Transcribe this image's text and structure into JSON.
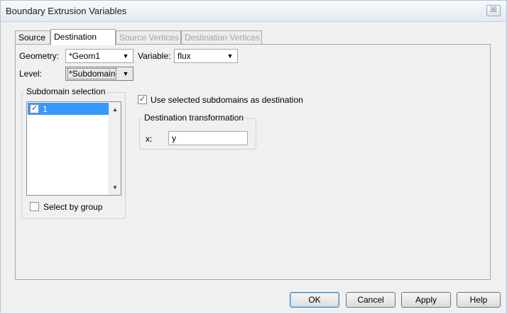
{
  "window": {
    "title": "Boundary Extrusion Variables",
    "close_glyph": "☒"
  },
  "tabs": [
    {
      "label": "Source",
      "state": "normal"
    },
    {
      "label": "Destination",
      "state": "active"
    },
    {
      "label": "Source Vertices",
      "state": "disabled"
    },
    {
      "label": "Destination Vertices",
      "state": "disabled"
    }
  ],
  "geometry": {
    "label": "Geometry:",
    "value": "*Geom1"
  },
  "variable": {
    "label": "Variable:",
    "value": "flux"
  },
  "level": {
    "label": "Level:",
    "value": "*Subdomain"
  },
  "subdomain_selection": {
    "title": "Subdomain selection",
    "items": [
      {
        "label": "1",
        "checked": true,
        "selected": true
      }
    ],
    "select_by_group": {
      "label": "Select by group",
      "checked": false
    }
  },
  "use_selected": {
    "label": "Use selected subdomains as destination",
    "checked": true
  },
  "destination_transformation": {
    "title": "Destination transformation",
    "x_label": "x:",
    "x_value": "y"
  },
  "buttons": {
    "ok": "OK",
    "cancel": "Cancel",
    "apply": "Apply",
    "help": "Help"
  },
  "icons": {
    "dropdown": "chevron-down-icon",
    "check": "check-icon",
    "close": "close-icon",
    "scroll_up": "scroll-up-icon",
    "scroll_down": "scroll-down-icon"
  },
  "colors": {
    "selection": "#3399ff",
    "dialog_bg": "#f0f0f0",
    "default_button_border": "#3c7fb1"
  }
}
